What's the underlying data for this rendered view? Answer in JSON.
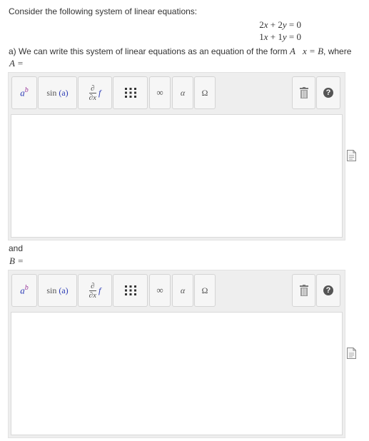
{
  "question": {
    "intro": "Consider the following system of linear equations:",
    "equations": [
      {
        "coef_x": "2",
        "coef_y": "2",
        "rhs": "0"
      },
      {
        "coef_x": "1",
        "coef_y": "1",
        "rhs": "0"
      }
    ],
    "part_a_text": "a) We can write this system of linear equations as an equation of the form ",
    "part_a_form": "A⃗x = B",
    "part_a_suffix": ", where",
    "label_A": "A =",
    "and_text": "and",
    "label_B": "B ="
  },
  "toolbar": {
    "buttons": [
      {
        "name": "superscript-button",
        "glyph_base": "a",
        "glyph_sup": "b"
      },
      {
        "name": "function-button",
        "label_fn": "sin",
        "label_arg": "(a)"
      },
      {
        "name": "derivative-button",
        "top": "∂",
        "bottom": "∂x",
        "fn": "f"
      },
      {
        "name": "matrix-button",
        "icon": "matrix-grid-icon"
      },
      {
        "name": "infinity-button",
        "label": "∞"
      },
      {
        "name": "greek-button",
        "label": "α"
      },
      {
        "name": "symbols-button",
        "label": "Ω"
      },
      {
        "name": "delete-button",
        "icon": "trash-icon"
      },
      {
        "name": "help-button",
        "label": "?"
      }
    ]
  },
  "colors": {
    "toolbar_bg": "#eeeeee",
    "button_bg": "#f6f6f6",
    "accent_blue": "#2b3bb5",
    "accent_purple": "#9b3a9b"
  },
  "side_icon": "document-icon"
}
